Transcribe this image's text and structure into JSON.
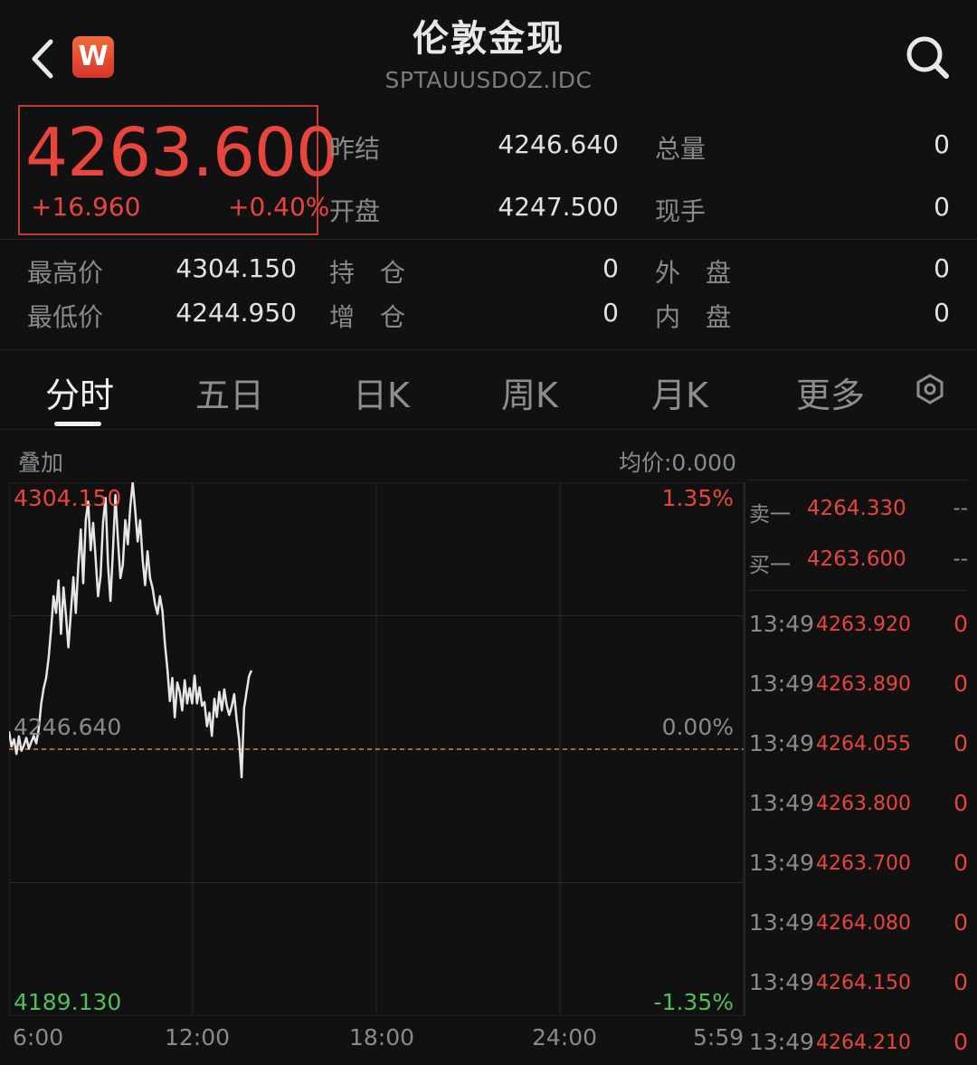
{
  "header": {
    "title": "伦敦金现",
    "symbol": "SPTAUUSDOZ.IDC",
    "logo_letter": "W"
  },
  "quote": {
    "price": "4263.600",
    "change": "+16.960",
    "change_pct": "+0.40%",
    "prev_settle_label": "昨结",
    "prev_settle": "4246.640",
    "open_label": "开盘",
    "open": "4247.500",
    "total_vol_label": "总量",
    "total_vol": "0",
    "current_hand_label": "现手",
    "current_hand": "0",
    "high_label": "最高价",
    "high": "4304.150",
    "low_label": "最低价",
    "low": "4244.950",
    "open_interest_label": "持　仓",
    "open_interest": "0",
    "oi_change_label": "增　仓",
    "oi_change": "0",
    "outer_label": "外　盘",
    "outer": "0",
    "inner_label": "内　盘",
    "inner": "0"
  },
  "tabs": [
    "分时",
    "五日",
    "日K",
    "周K",
    "月K",
    "更多"
  ],
  "active_tab": "分时",
  "chart_header": {
    "overlay_label": "叠加",
    "avg_label": "均价:0.000"
  },
  "chart_data": {
    "type": "line",
    "title": "",
    "y_max_label": "4304.150",
    "y_mid_label": "4246.640",
    "y_min_label": "4189.130",
    "pct_max_label": "1.35%",
    "pct_mid_label": "0.00%",
    "pct_min_label": "-1.35%",
    "x_tick_labels": [
      "6:00",
      "12:00",
      "18:00",
      "24:00",
      "5:59"
    ],
    "ylim": [
      4189.13,
      4304.15
    ],
    "baseline": 4246.64,
    "grid": true,
    "series": [
      {
        "values": [
          4250.5,
          4247.2,
          4248.8,
          4245.6,
          4249.4,
          4246.3,
          4247.5,
          4249.1,
          4246.8,
          4248.2,
          4249.5,
          4247.9,
          4251.0,
          4256.5,
          4259.8,
          4262.0,
          4266.4,
          4272.5,
          4279.6,
          4276.0,
          4283.0,
          4271.5,
          4281.5,
          4275.5,
          4268.6,
          4276.2,
          4283.7,
          4276.0,
          4286.4,
          4294.0,
          4282.4,
          4296.0,
          4300.0,
          4289.5,
          4295.4,
          4287.8,
          4279.6,
          4284.0,
          4295.5,
          4300.8,
          4286.5,
          4278.6,
          4289.6,
          4301.4,
          4292.0,
          4283.5,
          4286.4,
          4296.0,
          4290.8,
          4298.8,
          4304.15,
          4298.0,
          4291.4,
          4296.0,
          4287.4,
          4282.0,
          4289.3,
          4283.5,
          4281.4,
          4278.0,
          4275.8,
          4279.6,
          4276.4,
          4269.4,
          4264.0,
          4257.0,
          4262.0,
          4253.5,
          4261.0,
          4259.0,
          4255.0,
          4261.5,
          4256.5,
          4259.8,
          4256.5,
          4262.5,
          4256.5,
          4260.0,
          4256.0,
          4256.8,
          4251.6,
          4254.5,
          4249.5,
          4257.5,
          4253.6,
          4259.0,
          4255.0,
          4259.5,
          4256.0,
          4254.0,
          4255.8,
          4258.5,
          4253.0,
          4248.8,
          4240.6,
          4255.5,
          4258.9,
          4262.4,
          4263.6
        ]
      }
    ]
  },
  "order_book": {
    "ask_label": "卖一",
    "ask_price": "4264.330",
    "ask_vol": "--",
    "bid_label": "买一",
    "bid_price": "4263.600",
    "bid_vol": "--"
  },
  "ticks": [
    {
      "time": "13:49",
      "price": "4263.920",
      "vol": "0"
    },
    {
      "time": "13:49",
      "price": "4263.890",
      "vol": "0"
    },
    {
      "time": "13:49",
      "price": "4264.055",
      "vol": "0"
    },
    {
      "time": "13:49",
      "price": "4263.800",
      "vol": "0"
    },
    {
      "time": "13:49",
      "price": "4263.700",
      "vol": "0"
    },
    {
      "time": "13:49",
      "price": "4264.080",
      "vol": "0"
    },
    {
      "time": "13:49",
      "price": "4264.150",
      "vol": "0"
    },
    {
      "time": "13:49",
      "price": "4264.210",
      "vol": "0"
    }
  ],
  "colors": {
    "up": "#e8453c",
    "down": "#4fc05a",
    "line": "#e6e6e6",
    "baseline": "#d98a3a",
    "background": "#111111"
  }
}
